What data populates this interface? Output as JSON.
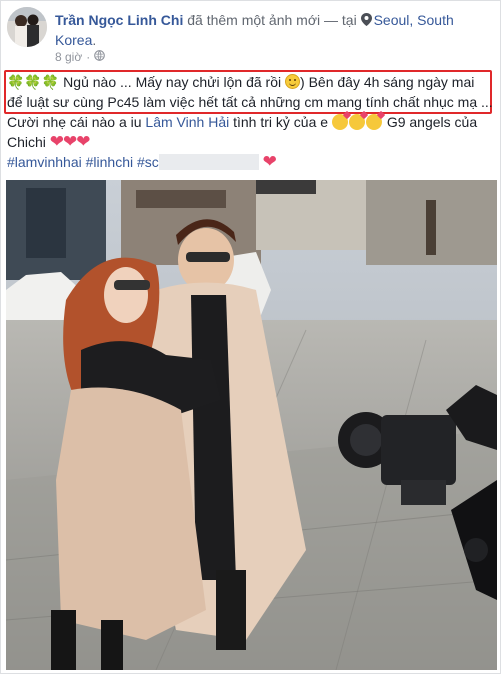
{
  "post": {
    "author": "Trần Ngọc Linh Chi",
    "action": " đã thêm một ảnh mới — tại ",
    "location": "Seoul, South Korea",
    "location_period": ".",
    "timestamp": "8 giờ",
    "separator": "·",
    "audience_icon": "globe-icon",
    "location_icon": "map-pin-icon",
    "text": {
      "leaf_emoji": "🍀🍀🍀",
      "line1": " Ngủ nào ... Mấy nay chửi lộn đã rồi ",
      "line1_after": ") Bên đây 4h sáng ngày mai để luật sư cùng Pc45 làm việc hết tất cả những cm mang tính chất nhục mạ ...",
      "line2_start": "Cười nhẹ cái nào a iu ",
      "mention": "Lâm Vinh Hải",
      "line2_mid": " tình tri kỷ của e ",
      "line2_end": " G9 angels của Chichi ",
      "hearts": "❤❤❤",
      "hashtag1": "#lamvinhhai",
      "hashtag2": "#linhchi",
      "hashtag3_visible": "#sc",
      "trailing_heart": "❤"
    }
  },
  "colors": {
    "link": "#365899",
    "highlight_border": "#e0282a",
    "muted": "#90949c"
  }
}
